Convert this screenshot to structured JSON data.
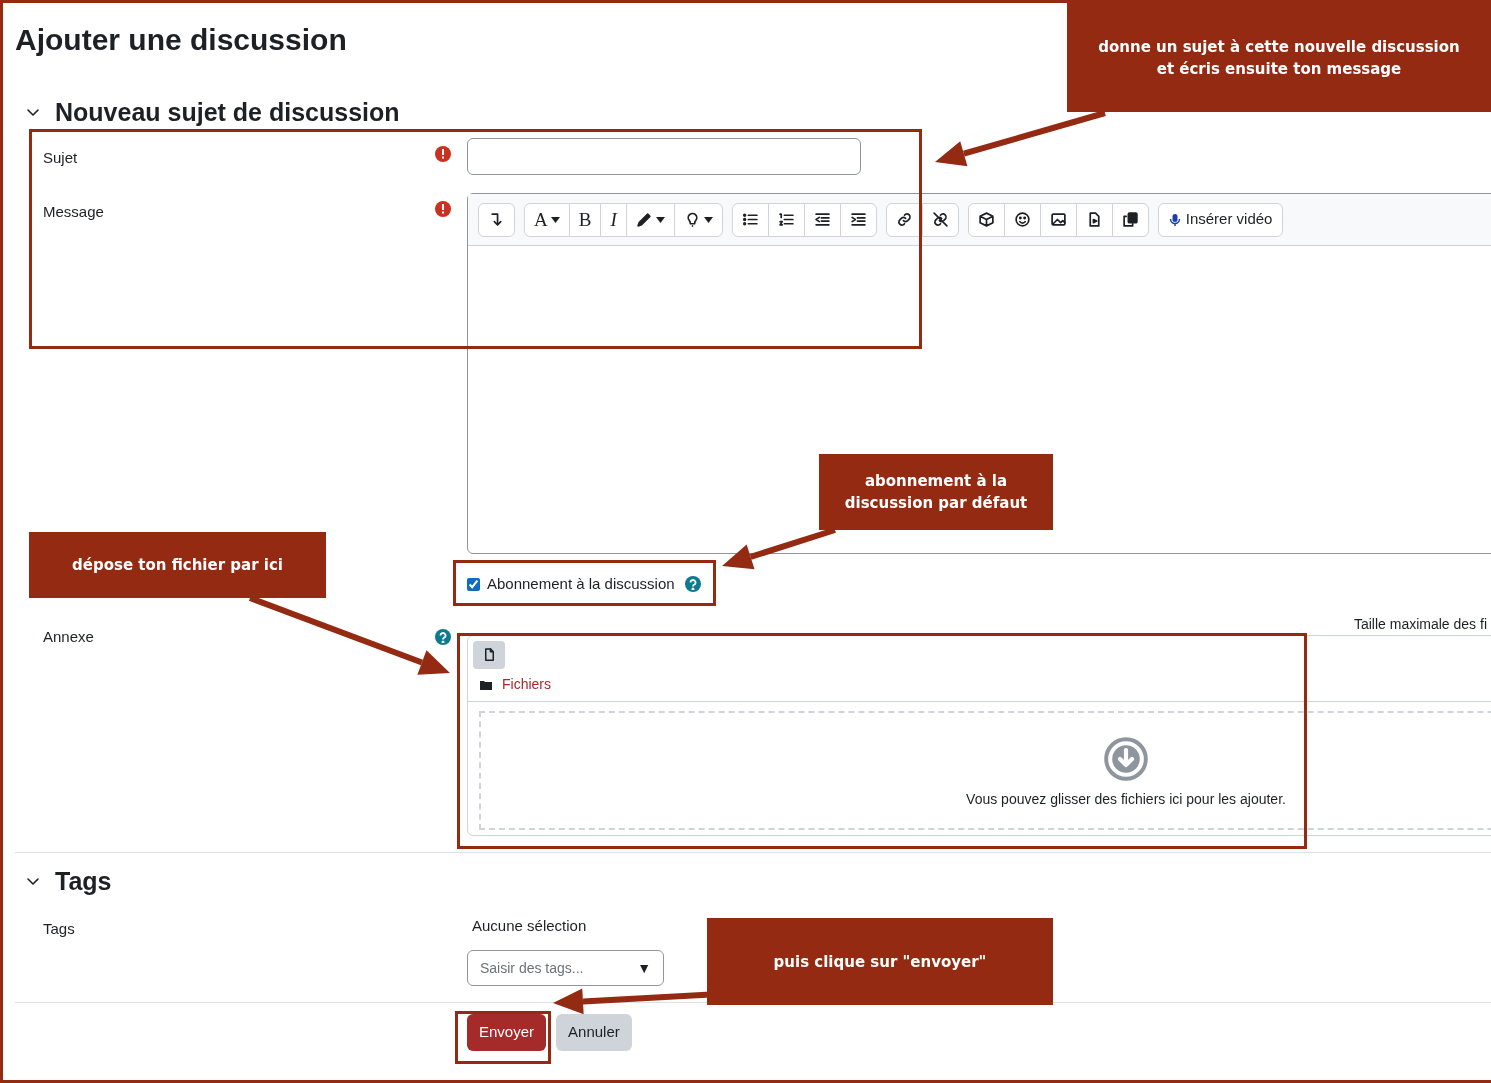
{
  "page_title": "Ajouter une discussion",
  "sections": [
    {
      "title": "Nouveau sujet de discussion",
      "expanded": true
    },
    {
      "title": "Tags",
      "expanded": true
    }
  ],
  "subject": {
    "label": "Sujet",
    "required": true
  },
  "message": {
    "label": "Message",
    "required": true,
    "toolbar": [
      [
        {
          "kind": "icon",
          "dropdown": false
        }
      ],
      [
        {
          "kind": "glyph",
          "text": "A",
          "dropdown": true
        },
        {
          "kind": "glyph",
          "text": "B",
          "dropdown": false
        },
        {
          "kind": "glyph",
          "text": "I",
          "dropdown": false
        },
        {
          "kind": "icon",
          "dropdown": true
        },
        {
          "kind": "icon",
          "dropdown": true
        }
      ],
      [
        {
          "kind": "icon",
          "dropdown": false
        },
        {
          "kind": "icon",
          "dropdown": false
        },
        {
          "kind": "icon",
          "dropdown": false
        },
        {
          "kind": "icon",
          "dropdown": false
        }
      ],
      [
        {
          "kind": "icon",
          "dropdown": false
        },
        {
          "kind": "icon",
          "dropdown": false
        }
      ],
      [
        {
          "kind": "icon",
          "dropdown": false
        },
        {
          "kind": "icon",
          "dropdown": false
        },
        {
          "kind": "icon",
          "dropdown": false
        },
        {
          "kind": "icon",
          "dropdown": false
        },
        {
          "kind": "icon",
          "dropdown": false
        }
      ]
    ],
    "video_button": "Insérer vidéo"
  },
  "subscription": {
    "label": "Abonnement à la discussion",
    "checked": true
  },
  "attachment": {
    "label": "Annexe",
    "max_size": "Taille maximale des fi",
    "folder": "Fichiers",
    "drop_hint": "Vous pouvez glisser des fichiers ici pour les ajouter."
  },
  "tags": {
    "label": "Tags",
    "selection": "Aucune sélection",
    "placeholder": "Saisir des tags...",
    "caret": "▼"
  },
  "buttons": [
    {
      "label": "Envoyer",
      "kind": "primary"
    },
    {
      "label": "Annuler",
      "kind": "secondary"
    }
  ],
  "callouts": [
    {
      "text": "donne un sujet à cette nouvelle discussion et écris ensuite ton message"
    },
    {
      "text": "abonnement à la discussion par défaut"
    },
    {
      "text": "dépose ton fichier par ici"
    },
    {
      "text": "puis clique sur \"envoyer\""
    }
  ]
}
